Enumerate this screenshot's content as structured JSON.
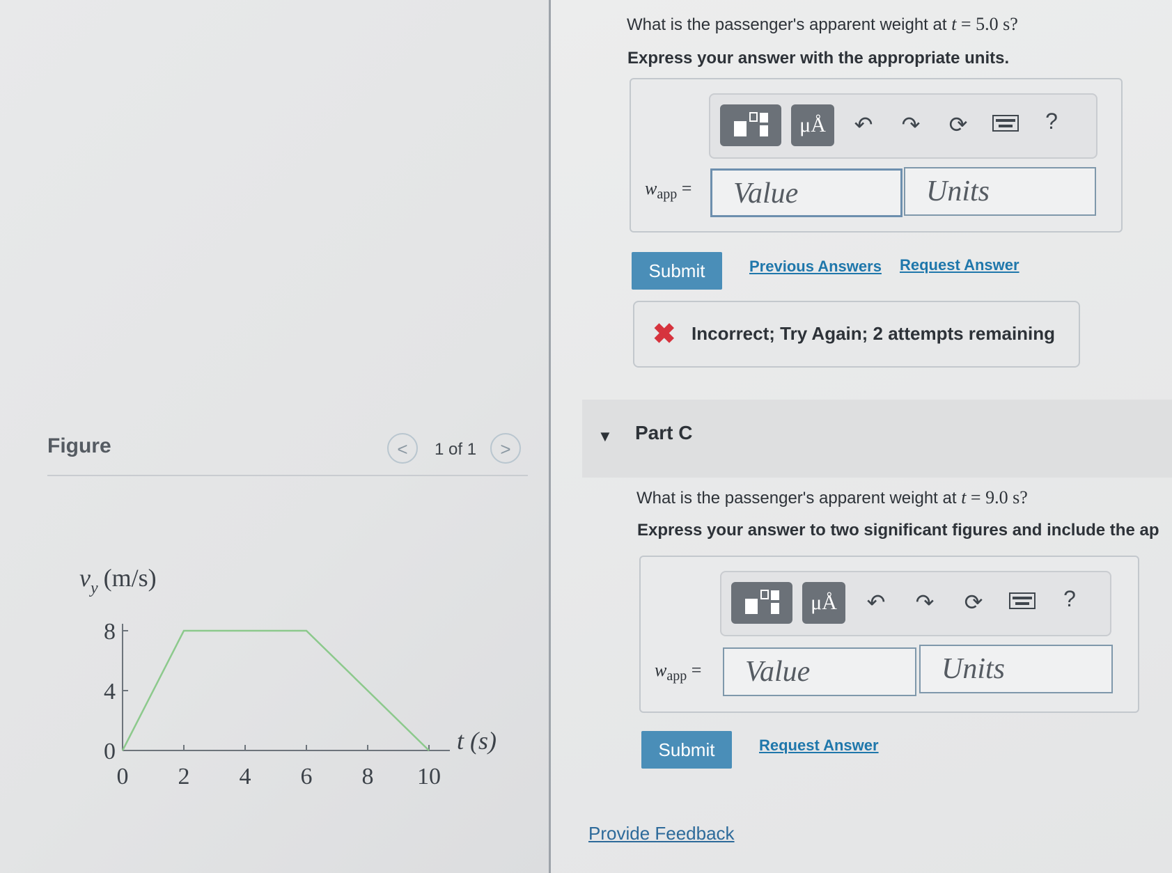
{
  "figure": {
    "title": "Figure",
    "pager": "1 of 1",
    "prev_icon": "<",
    "next_icon": ">"
  },
  "chart_data": {
    "type": "line",
    "xlabel": "t (s)",
    "ylabel_main": "v",
    "ylabel_sub": "y",
    "ylabel_units": "(m/s)",
    "x_ticks": [
      "0",
      "2",
      "4",
      "6",
      "8",
      "10"
    ],
    "y_ticks": [
      "0",
      "4",
      "8"
    ],
    "xlim": [
      0,
      10
    ],
    "ylim": [
      0,
      8
    ],
    "series": [
      {
        "x": [
          0,
          2,
          6,
          10
        ],
        "y": [
          0,
          8,
          8,
          0
        ],
        "color": "#8cc98c"
      }
    ]
  },
  "part_b": {
    "question_prefix": "What is the passenger's apparent weight at ",
    "question_var": "t",
    "question_value": " = 5.0 s?",
    "instruction": "Express your answer with the appropriate units.",
    "var_main": "w",
    "var_sub": "app",
    "equals": "=",
    "value_placeholder": "Value",
    "units_placeholder": "Units",
    "submit": "Submit",
    "previous_answers": "Previous Answers",
    "request_answer": "Request Answer",
    "feedback": "Incorrect; Try Again; 2 attempts remaining",
    "feedback_icon": "✖"
  },
  "part_c": {
    "title": "Part C",
    "question_prefix": "What is the passenger's apparent weight at ",
    "question_var": "t",
    "question_value": " = 9.0 s?",
    "instruction": "Express your answer to two significant figures and include the ap",
    "var_main": "w",
    "var_sub": "app",
    "equals": "=",
    "value_placeholder": "Value",
    "units_placeholder": "Units",
    "submit": "Submit",
    "request_answer": "Request Answer"
  },
  "toolbar": {
    "units_btn": "μÅ",
    "help": "?"
  },
  "provide_feedback": "Provide Feedback",
  "colors": {
    "submit": "#4a8eb8",
    "link": "#1f77ab",
    "error": "#d6333d",
    "plot_line": "#8cc98c"
  }
}
